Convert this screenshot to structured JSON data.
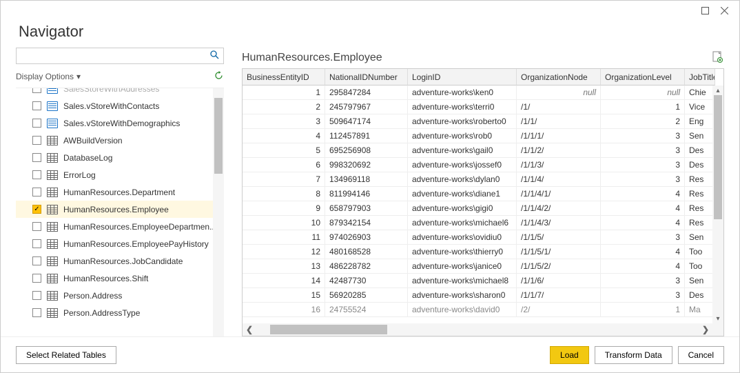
{
  "window": {
    "title": "Navigator"
  },
  "search": {
    "placeholder": ""
  },
  "display_options": {
    "label": "Display Options"
  },
  "tree": {
    "items": [
      {
        "label": "SalesStoreWithAddresses",
        "icon": "view",
        "checked": false,
        "cut": true
      },
      {
        "label": "Sales.vStoreWithContacts",
        "icon": "view",
        "checked": false
      },
      {
        "label": "Sales.vStoreWithDemographics",
        "icon": "view",
        "checked": false
      },
      {
        "label": "AWBuildVersion",
        "icon": "table",
        "checked": false
      },
      {
        "label": "DatabaseLog",
        "icon": "table",
        "checked": false
      },
      {
        "label": "ErrorLog",
        "icon": "table",
        "checked": false
      },
      {
        "label": "HumanResources.Department",
        "icon": "table",
        "checked": false
      },
      {
        "label": "HumanResources.Employee",
        "icon": "table",
        "checked": true,
        "selected": true
      },
      {
        "label": "HumanResources.EmployeeDepartmen...",
        "icon": "table",
        "checked": false
      },
      {
        "label": "HumanResources.EmployeePayHistory",
        "icon": "table",
        "checked": false
      },
      {
        "label": "HumanResources.JobCandidate",
        "icon": "table",
        "checked": false
      },
      {
        "label": "HumanResources.Shift",
        "icon": "table",
        "checked": false
      },
      {
        "label": "Person.Address",
        "icon": "table",
        "checked": false
      },
      {
        "label": "Person.AddressType",
        "icon": "table",
        "checked": false
      }
    ]
  },
  "preview": {
    "title": "HumanResources.Employee",
    "columns": [
      "BusinessEntityID",
      "NationalIDNumber",
      "LoginID",
      "OrganizationNode",
      "OrganizationLevel",
      "JobTitle"
    ],
    "rows": [
      {
        "id": "1",
        "nid": "295847284",
        "login": "adventure-works\\ken0",
        "node": "null",
        "level": "null",
        "title": "Chie"
      },
      {
        "id": "2",
        "nid": "245797967",
        "login": "adventure-works\\terri0",
        "node": "/1/",
        "level": "1",
        "title": "Vice"
      },
      {
        "id": "3",
        "nid": "509647174",
        "login": "adventure-works\\roberto0",
        "node": "/1/1/",
        "level": "2",
        "title": "Eng"
      },
      {
        "id": "4",
        "nid": "112457891",
        "login": "adventure-works\\rob0",
        "node": "/1/1/1/",
        "level": "3",
        "title": "Sen"
      },
      {
        "id": "5",
        "nid": "695256908",
        "login": "adventure-works\\gail0",
        "node": "/1/1/2/",
        "level": "3",
        "title": "Des"
      },
      {
        "id": "6",
        "nid": "998320692",
        "login": "adventure-works\\jossef0",
        "node": "/1/1/3/",
        "level": "3",
        "title": "Des"
      },
      {
        "id": "7",
        "nid": "134969118",
        "login": "adventure-works\\dylan0",
        "node": "/1/1/4/",
        "level": "3",
        "title": "Res"
      },
      {
        "id": "8",
        "nid": "811994146",
        "login": "adventure-works\\diane1",
        "node": "/1/1/4/1/",
        "level": "4",
        "title": "Res"
      },
      {
        "id": "9",
        "nid": "658797903",
        "login": "adventure-works\\gigi0",
        "node": "/1/1/4/2/",
        "level": "4",
        "title": "Res"
      },
      {
        "id": "10",
        "nid": "879342154",
        "login": "adventure-works\\michael6",
        "node": "/1/1/4/3/",
        "level": "4",
        "title": "Res"
      },
      {
        "id": "11",
        "nid": "974026903",
        "login": "adventure-works\\ovidiu0",
        "node": "/1/1/5/",
        "level": "3",
        "title": "Sen"
      },
      {
        "id": "12",
        "nid": "480168528",
        "login": "adventure-works\\thierry0",
        "node": "/1/1/5/1/",
        "level": "4",
        "title": "Too"
      },
      {
        "id": "13",
        "nid": "486228782",
        "login": "adventure-works\\janice0",
        "node": "/1/1/5/2/",
        "level": "4",
        "title": "Too"
      },
      {
        "id": "14",
        "nid": "42487730",
        "login": "adventure-works\\michael8",
        "node": "/1/1/6/",
        "level": "3",
        "title": "Sen"
      },
      {
        "id": "15",
        "nid": "56920285",
        "login": "adventure-works\\sharon0",
        "node": "/1/1/7/",
        "level": "3",
        "title": "Des"
      },
      {
        "id": "16",
        "nid": "24755524",
        "login": "adventure-works\\david0",
        "node": "/2/",
        "level": "1",
        "title": "Ma",
        "cut": true
      }
    ]
  },
  "footer": {
    "select_related": "Select Related Tables",
    "load": "Load",
    "transform": "Transform Data",
    "cancel": "Cancel"
  }
}
